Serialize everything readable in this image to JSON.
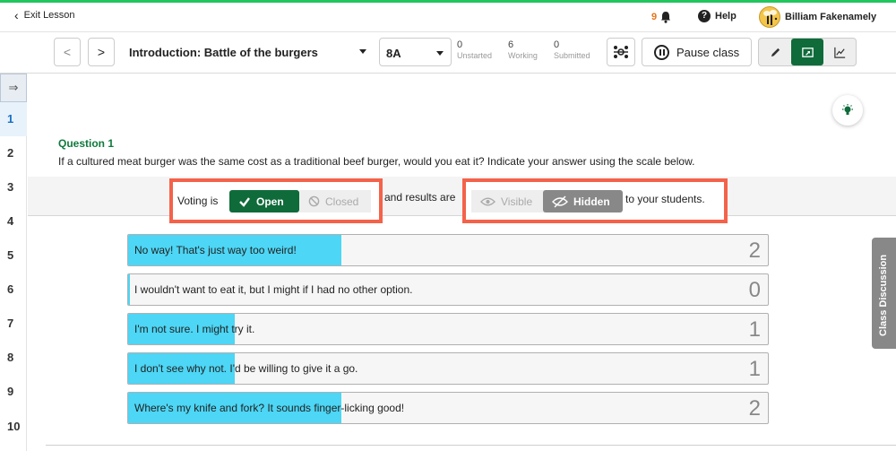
{
  "topbar": {
    "exit_label": "Exit Lesson",
    "notification_count": "9",
    "help_label": "Help",
    "user_name": "Billiam Fakenamely"
  },
  "toolbar": {
    "lesson_title": "Introduction: Battle of the burgers",
    "class_name": "8A",
    "stats": [
      {
        "value": "0",
        "label": "Unstarted"
      },
      {
        "value": "6",
        "label": "Working"
      },
      {
        "value": "0",
        "label": "Submitted"
      }
    ],
    "pause_label": "Pause class"
  },
  "sidebar": {
    "collapse_glyph": "⇒",
    "questions": [
      "1",
      "2",
      "3",
      "4",
      "5",
      "6",
      "7",
      "8",
      "9",
      "10"
    ],
    "active_index": 0
  },
  "question": {
    "label": "Question 1",
    "text": "If a cultured meat burger was the same cost as a traditional beef burger, would you eat it? Indicate your answer using the scale below."
  },
  "controls": {
    "voting_prefix": "Voting is",
    "open_label": "Open",
    "closed_label": "Closed",
    "results_prefix": "and results are",
    "visible_label": "Visible",
    "hidden_label": "Hidden",
    "suffix": "to your students."
  },
  "answers": [
    {
      "text": "No way! That's just way too weird!",
      "count": "2",
      "fill_fraction": 0.333
    },
    {
      "text": "I wouldn't want to eat it, but I might if I had no other option.",
      "count": "0",
      "fill_fraction": 0.0
    },
    {
      "text": "I'm not sure. I might try it.",
      "count": "1",
      "fill_fraction": 0.167
    },
    {
      "text": "I don't see why not. I'd be willing to give it a go.",
      "count": "1",
      "fill_fraction": 0.167
    },
    {
      "text": "Where's my knife and fork? It sounds finger-licking good!",
      "count": "2",
      "fill_fraction": 0.333
    }
  ],
  "discussion_label": "Class Discussion",
  "colors": {
    "accent_green": "#0f6b3a",
    "bar_fill": "#4dd6f5",
    "highlight": "#f4624a"
  }
}
